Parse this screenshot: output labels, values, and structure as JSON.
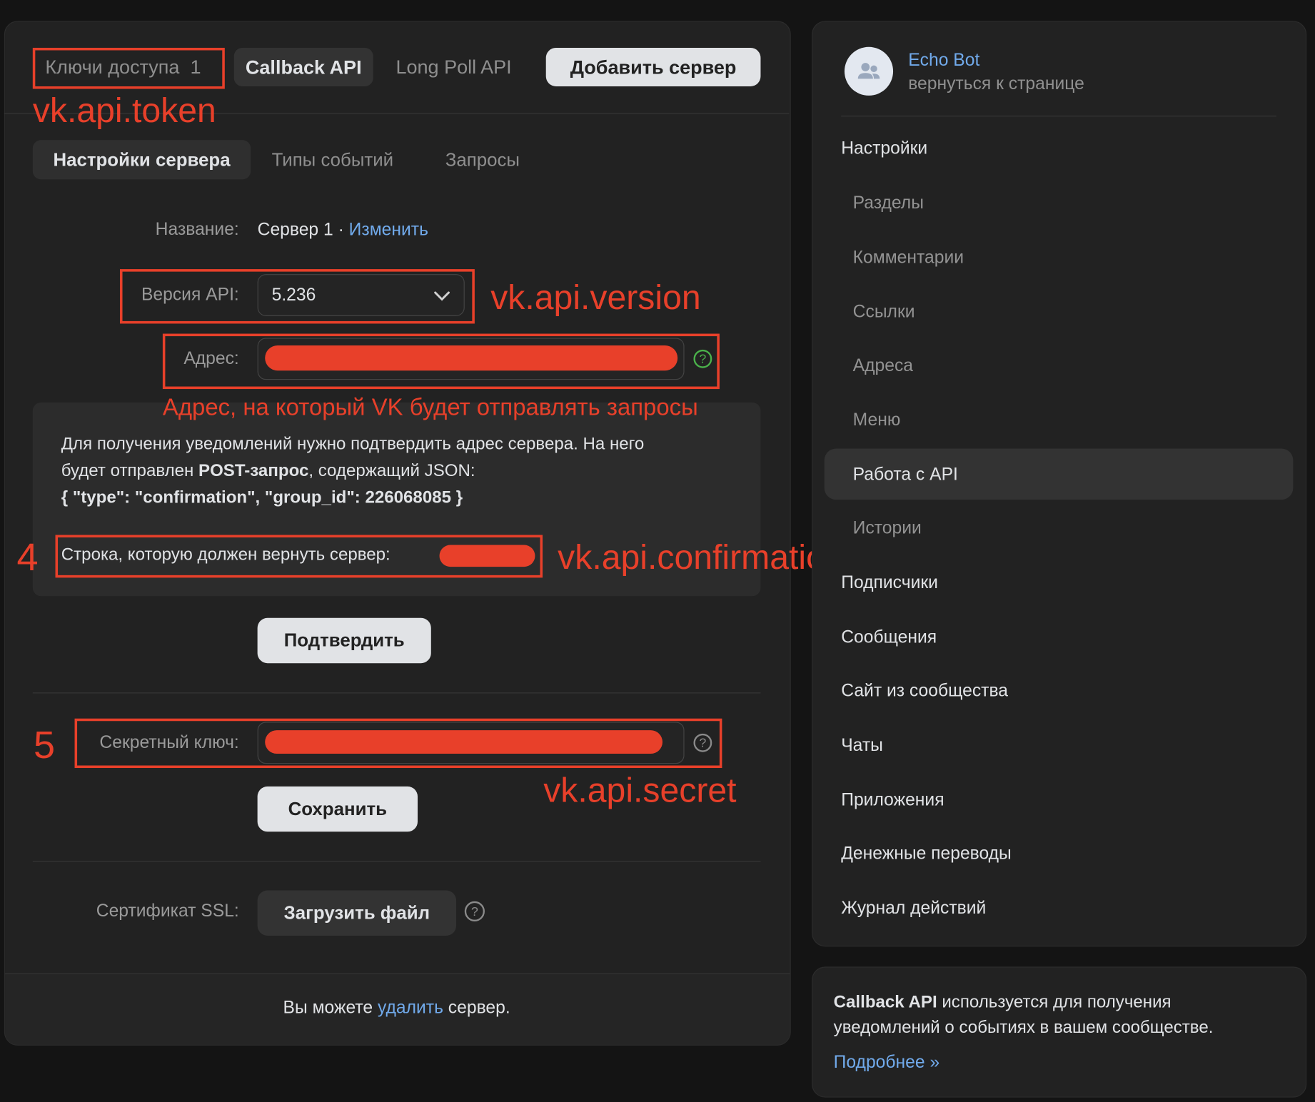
{
  "top_tabs": {
    "access_keys": "Ключи доступа",
    "access_keys_count": "1",
    "callback_api": "Callback API",
    "long_poll_api": "Long Poll API",
    "add_server": "Добавить сервер"
  },
  "sub_tabs": {
    "server_settings": "Настройки сервера",
    "event_types": "Типы событий",
    "requests": "Запросы"
  },
  "form": {
    "name_label": "Название:",
    "name_value": "Сервер 1 · ",
    "name_change": "Изменить",
    "api_version_label": "Версия API:",
    "api_version_value": "5.236",
    "address_label": "Адрес:",
    "info_line1": "Для получения уведомлений нужно подтвердить адрес сервера. На него",
    "info_line2_prefix": "будет отправлен ",
    "info_line2_bold": "POST-запрос",
    "info_line2_suffix": ", содержащий JSON:",
    "info_json": "{ \"type\": \"confirmation\", \"group_id\": 226068085 }",
    "confirm_string_label": "Строка, которую должен вернуть сервер:",
    "confirm_button": "Подтвердить",
    "secret_label": "Секретный ключ:",
    "save_button": "Сохранить",
    "ssl_label": "Сертификат SSL:",
    "upload_button": "Загрузить файл",
    "footer_prefix": "Вы можете ",
    "footer_link": "удалить",
    "footer_suffix": " сервер."
  },
  "annotations": {
    "token": "vk.api.token",
    "version": "vk.api.version",
    "address_caption": "Адрес, на который VK будет отправлять запросы",
    "step4": "4",
    "confirmation": "vk.api.confirmation",
    "step5": "5",
    "secret": "vk.api.secret"
  },
  "sidebar": {
    "group_name": "Echo Bot",
    "back_link": "вернуться к странице",
    "settings_header": "Настройки",
    "sub_items": [
      {
        "label": "Разделы"
      },
      {
        "label": "Комментарии"
      },
      {
        "label": "Ссылки"
      },
      {
        "label": "Адреса"
      },
      {
        "label": "Меню"
      },
      {
        "label": "Работа с API",
        "selected": true
      },
      {
        "label": "Истории"
      }
    ],
    "items": [
      {
        "label": "Подписчики"
      },
      {
        "label": "Сообщения"
      },
      {
        "label": "Сайт из сообщества"
      },
      {
        "label": "Чаты"
      },
      {
        "label": "Приложения"
      },
      {
        "label": "Денежные переводы"
      },
      {
        "label": "Журнал действий"
      }
    ]
  },
  "info_card": {
    "bold": "Callback API",
    "text1": " используется для получения",
    "text2": "уведомлений о событиях в вашем сообществе.",
    "more_link": "Подробнее »"
  },
  "colors": {
    "accent_link": "#71aaeb",
    "annotation_red": "#e8402a",
    "background": "#141414",
    "panel": "#222222"
  }
}
